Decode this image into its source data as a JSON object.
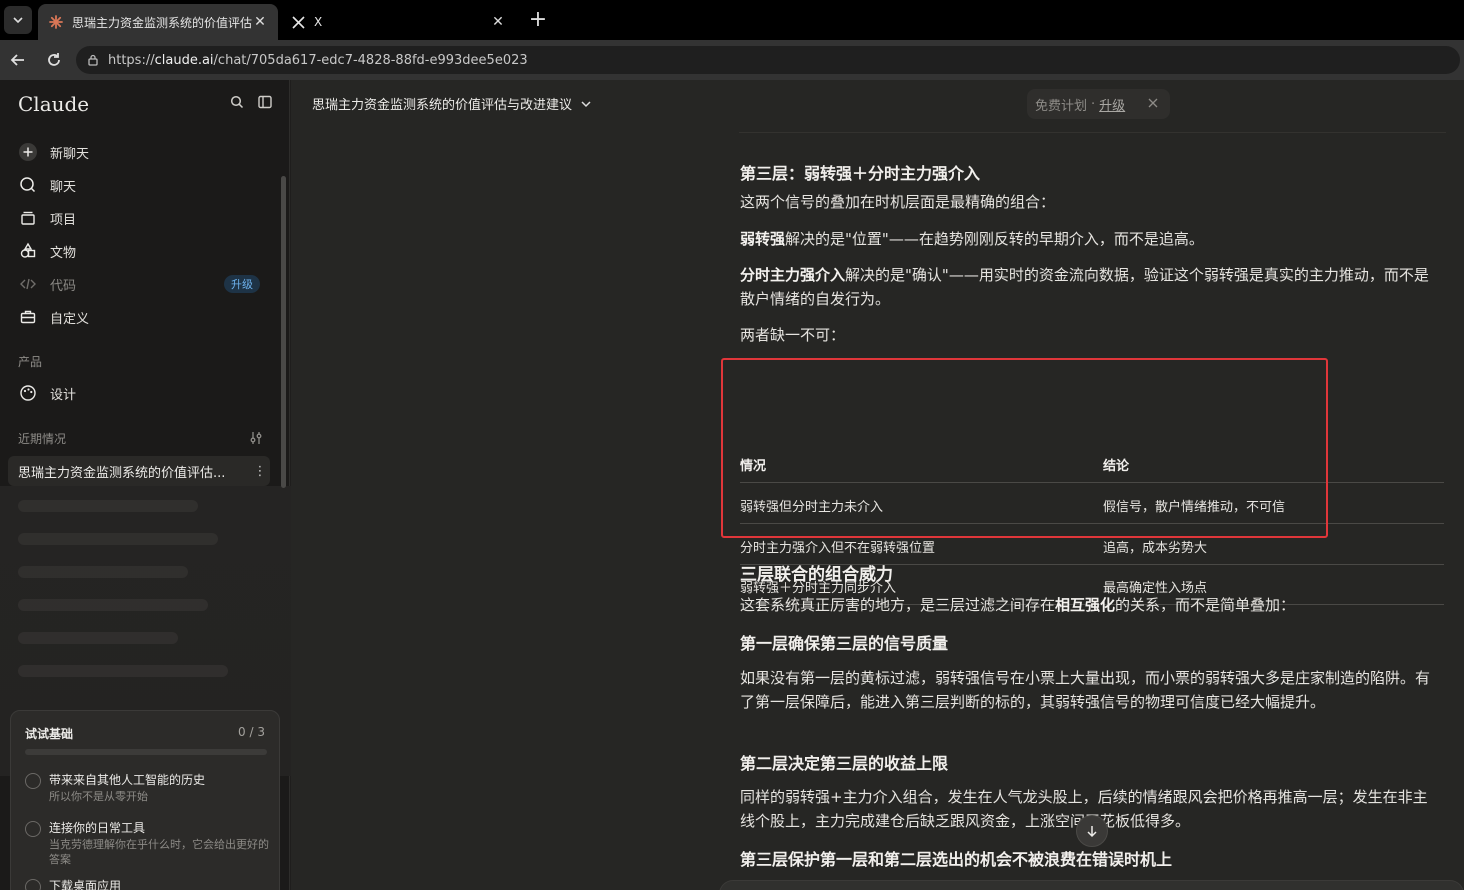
{
  "browser": {
    "tabs": [
      {
        "title": "思瑞主力资金监测系统的价值评估",
        "close": "✕",
        "icon": "claude-logo-icon"
      },
      {
        "title": "X",
        "close": "✕",
        "icon": "x-logo-icon"
      }
    ],
    "new_tab": "+",
    "url_scheme": "https://",
    "url_host": "claude.ai",
    "url_path": "/chat/705da617-edc7-4828-88fd-e993dee5e023"
  },
  "sidebar": {
    "brand": "Claude",
    "nav": [
      {
        "label": "新聊天",
        "icon": "plus-circle-icon"
      },
      {
        "label": "聊天",
        "icon": "chat-bubble-icon"
      },
      {
        "label": "项目",
        "icon": "folder-stack-icon"
      },
      {
        "label": "文物",
        "icon": "shapes-icon"
      },
      {
        "label": "代码",
        "icon": "code-icon",
        "badge": "升级"
      },
      {
        "label": "自定义",
        "icon": "briefcase-icon"
      }
    ],
    "products_label": "产品",
    "products": [
      {
        "label": "设计",
        "icon": "palette-icon"
      }
    ],
    "recents_label": "近期情况",
    "recent_active": "思瑞主力资金监测系统的价值评估...",
    "recent_more": "⋮",
    "try_card": {
      "title": "试试基础",
      "count": "0 / 3",
      "progress": 0,
      "items": [
        {
          "title": "带来来自其他人工智能的历史",
          "desc": "所以你不是从零开始"
        },
        {
          "title": "连接你的日常工具",
          "desc": "当克劳德理解你在乎什么时，它会给出更好的答案"
        },
        {
          "title": "下载桌面应用",
          "desc": ""
        }
      ]
    }
  },
  "header": {
    "chat_title": "思瑞主力资金监测系统的价值评估与改进建议",
    "plan_label": "免费计划",
    "plan_sep": "·",
    "plan_upgrade": "升级"
  },
  "message": {
    "h_layer3": "第三层：弱转强＋分时主力强介入",
    "p1": "这两个信号的叠加在时机层面是最精确的组合：",
    "p2_bold": "弱转强",
    "p2_rest": "解决的是\"位置\"——在趋势刚刚反转的早期介入，而不是追高。",
    "p3_bold": "分时主力强介入",
    "p3_rest": "解决的是\"确认\"——用实时的资金流向数据，验证这个弱转强是真实的主力推动，而不是散户情绪的自发行为。",
    "p4": "两者缺一不可：",
    "table": {
      "headers": [
        "情况",
        "结论"
      ],
      "rows": [
        [
          "弱转强但分时主力未介入",
          "假信号，散户情绪推动，不可信"
        ],
        [
          "分时主力强介入但不在弱转强位置",
          "追高，成本劣势大"
        ],
        [
          "弱转强＋分时主力同步介入",
          "最高确定性入场点"
        ]
      ]
    },
    "h_combo": "三层联合的组合威力",
    "p5_a": "这套系统真正厉害的地方，是三层过滤之间存在",
    "p5_bold": "相互强化",
    "p5_b": "的关系，而不是简单叠加：",
    "h_first": "第一层确保第三层的信号质量",
    "p6": "如果没有第一层的黄标过滤，弱转强信号在小票上大量出现，而小票的弱转强大多是庄家制造的陷阱。有了第一层保障后，能进入第三层判断的标的，其弱转强信号的物理可信度已经大幅提升。",
    "h_second": "第二层决定第三层的收益上限",
    "p7": "同样的弱转强+主力介入组合，发生在人气龙头股上，后续的情绪跟风会把价格再推高一层；发生在非主线个股上，主力完成建仓后缺乏跟风资金，上涨空间天花板低得多。",
    "h_third": "第三层保护第一层和第二层选出的机会不被浪费在错误时机上"
  }
}
